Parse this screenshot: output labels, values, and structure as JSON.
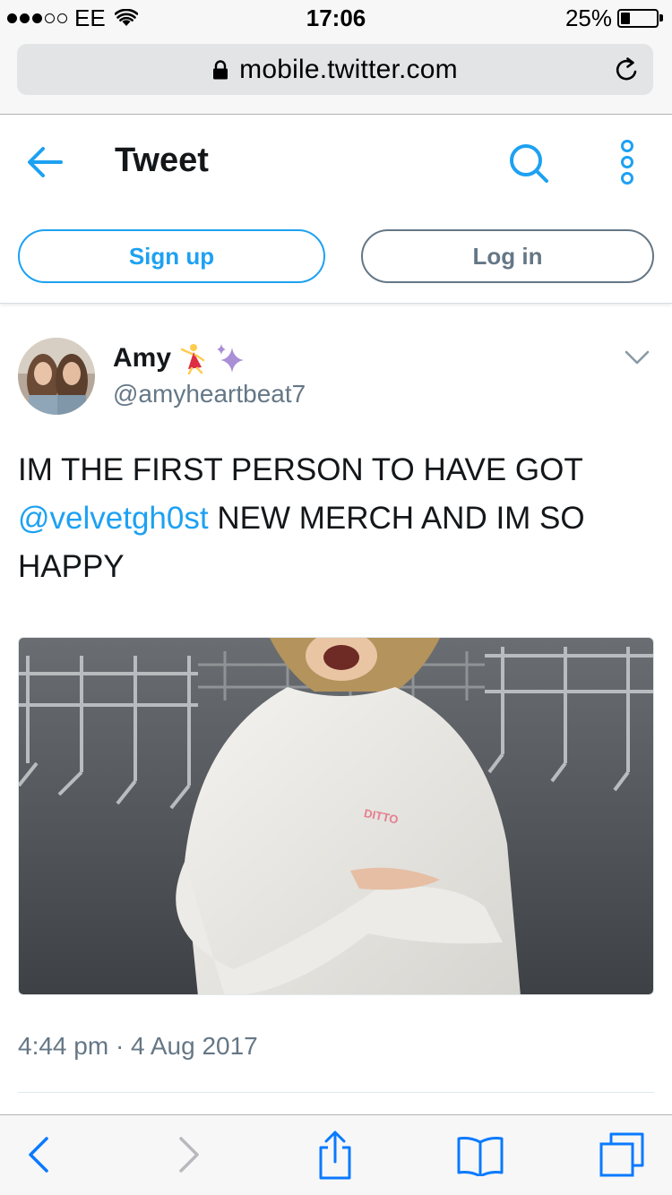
{
  "status_bar": {
    "signal_bars_filled": 3,
    "signal_bars_total": 5,
    "carrier": "EE",
    "time": "17:06",
    "battery_percent": "25%",
    "battery_level": 0.25,
    "icons": [
      "wifi-icon",
      "battery-icon"
    ]
  },
  "browser": {
    "url": "mobile.twitter.com",
    "icons": [
      "lock-icon",
      "reload-icon"
    ]
  },
  "header": {
    "title": "Tweet",
    "icons": [
      "back-arrow-icon",
      "search-icon",
      "more-options-icon"
    ],
    "signup_label": "Sign up",
    "login_label": "Log in"
  },
  "tweet": {
    "author_name": "Amy",
    "author_emojis": [
      "dancer-emoji",
      "sparkles-emoji"
    ],
    "handle": "@amyheartbeat7",
    "text_before": "IM THE FIRST PERSON TO HAVE GOT ",
    "mention": "@velvetgh0st",
    "text_after": " NEW MERCH AND IM SO HAPPY",
    "photo_print": "DITTO",
    "timestamp": "4:44 pm · 4 Aug 2017"
  },
  "toolbar": {
    "icons": [
      "back-icon",
      "forward-icon",
      "share-icon",
      "bookmarks-icon",
      "tabs-icon"
    ]
  },
  "colors": {
    "twitter_blue": "#1da1f2",
    "secondary_text": "#657786",
    "primary_text": "#14171a",
    "safari_blue": "#0a7aff"
  }
}
